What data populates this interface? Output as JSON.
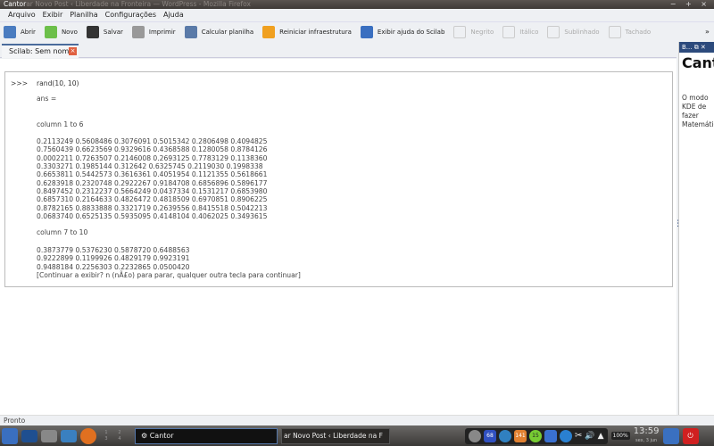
{
  "titlebar": {
    "title": "Cantor",
    "background_title": "ar Novo Post ‹ Liberdade na Fronteira — WordPress - Mozilla Firefox",
    "controls": "− + ×"
  },
  "menu": [
    "Arquivo",
    "Exibir",
    "Planilha",
    "Configurações",
    "Ajuda"
  ],
  "toolbar": [
    {
      "label": "Abrir",
      "icon": "printer-open-icon",
      "color": "#4a7cc0"
    },
    {
      "label": "Novo",
      "icon": "new-document-icon",
      "color": "#6cbf4a"
    },
    {
      "label": "Salvar",
      "icon": "save-icon",
      "color": "#333"
    },
    {
      "label": "Imprimir",
      "icon": "print-icon",
      "color": "#999"
    },
    {
      "label": "Calcular planilha",
      "icon": "gear-icon",
      "color": "#5a7aa8"
    },
    {
      "label": "Reiniciar infraestrutura",
      "icon": "restart-icon",
      "color": "#f0a020"
    },
    {
      "label": "Exibir ajuda do Scilab",
      "icon": "help-book-icon",
      "color": "#3a6fc0"
    },
    {
      "label": "Negrito",
      "icon": "bold-icon",
      "disabled": true
    },
    {
      "label": "Itálico",
      "icon": "italic-icon",
      "disabled": true
    },
    {
      "label": "Sublinhado",
      "icon": "underline-icon",
      "disabled": true
    },
    {
      "label": "Tachado",
      "icon": "strikethrough-icon",
      "disabled": true
    }
  ],
  "toolbar_overflow": "»",
  "tab": {
    "label": "Scilab: Sem nome",
    "close": "×"
  },
  "worksheet": {
    "prompt": ">>>",
    "command": "rand(10, 10)",
    "ans": "ans =",
    "header1": "column 1 to 6",
    "rows1": [
      "0.2113249 0.5608486 0.3076091 0.5015342 0.2806498 0.4094825",
      "0.7560439 0.6623569 0.9329616 0.4368588 0.1280058 0.8784126",
      "0.0002211 0.7263507 0.2146008 0.2693125 0.7783129 0.1138360",
      "0.3303271 0.1985144 0.312642 0.6325745 0.2119030 0.1998338",
      "0.6653811 0.5442573 0.3616361 0.4051954 0.1121355 0.5618661",
      "0.6283918 0.2320748 0.2922267 0.9184708 0.6856896 0.5896177",
      "0.8497452 0.2312237 0.5664249 0.0437334 0.1531217 0.6853980",
      "0.6857310 0.2164633 0.4826472 0.4818509 0.6970851 0.8906225",
      "0.8782165 0.8833888 0.3321719 0.2639556 0.8415518 0.5042213",
      "0.0683740 0.6525135 0.5935095 0.4148104 0.4062025 0.3493615"
    ],
    "header2": "column 7 to 10",
    "rows2": [
      "0.3873779 0.5376230 0.5878720 0.6488563",
      "0.9222899 0.1199926 0.4829179 0.9923191",
      "0.9488184 0.2256303 0.2232865 0.0500420"
    ],
    "continue_prompt": "[Continuar a exibir? n (nÃ£o) para parar, qualquer outra tecla para continuar]"
  },
  "dock": {
    "header": "B...  ⧉ ✕",
    "title": "Cantor",
    "subtitle": "O modo KDE de fazer Matemática"
  },
  "status": "Pronto",
  "taskbar": {
    "tasks": [
      "Cantor",
      "ar Novo Post ‹ Liberdade na F"
    ],
    "pager": [
      "1",
      "2",
      "3",
      "4"
    ],
    "tray_badges": [
      "68",
      "141",
      "15"
    ],
    "battery": "100%",
    "time": "13:59",
    "date": "sex, 3 jun"
  }
}
